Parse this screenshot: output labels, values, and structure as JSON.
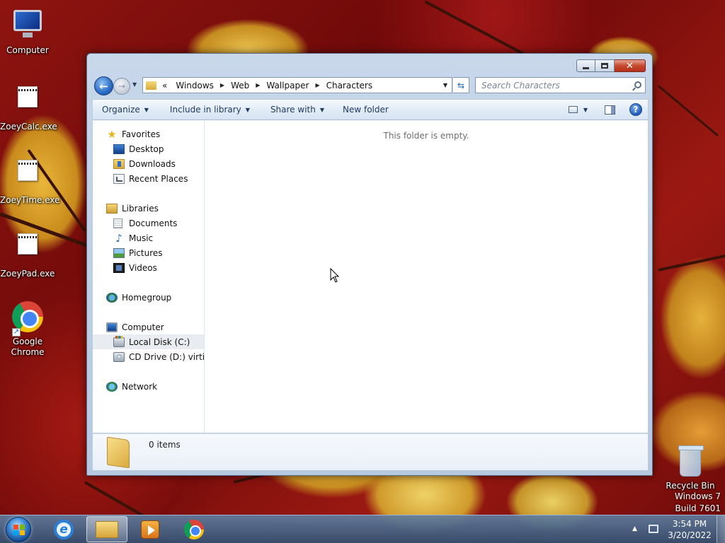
{
  "desktop": {
    "icons": [
      {
        "label": "Computer",
        "icon": "computer-icon"
      },
      {
        "label": "ZoeyCalc.exe",
        "icon": "exe-icon"
      },
      {
        "label": "ZoeyTime.exe",
        "icon": "exe-icon"
      },
      {
        "label": "ZoeyPad.exe",
        "icon": "exe-icon"
      },
      {
        "label": "Google Chrome",
        "icon": "chrome-icon"
      },
      {
        "label": "Recycle Bin",
        "icon": "recycle-bin-icon"
      }
    ],
    "watermark": {
      "line1": "Windows 7",
      "line2": "Build 7601"
    }
  },
  "explorer": {
    "address": {
      "overflow": "«",
      "crumbs": [
        "Windows",
        "Web",
        "Wallpaper",
        "Characters"
      ]
    },
    "search": {
      "placeholder": "Search Characters"
    },
    "commands": {
      "organize": "Organize",
      "include_in_library": "Include in library",
      "share_with": "Share with",
      "new_folder": "New folder"
    },
    "nav": {
      "favorites": "Favorites",
      "desktop": "Desktop",
      "downloads": "Downloads",
      "recent_places": "Recent Places",
      "libraries": "Libraries",
      "documents": "Documents",
      "music": "Music",
      "pictures": "Pictures",
      "videos": "Videos",
      "homegroup": "Homegroup",
      "computer": "Computer",
      "local_disk": "Local Disk (C:)",
      "cd_drive": "CD Drive (D:) virtio-win",
      "network": "Network"
    },
    "content": {
      "empty_message": "This folder is empty."
    },
    "details": {
      "items_count": "0 items"
    }
  },
  "taskbar": {
    "clock": {
      "time": "3:54 PM",
      "date": "3/20/2022"
    },
    "pinned": [
      "internet-explorer-icon",
      "windows-explorer-icon",
      "media-player-icon",
      "chrome-icon"
    ]
  },
  "colors": {
    "accent": "#2a6bc4",
    "taskbar": "#4a6a90",
    "close_button": "#c44a2f"
  }
}
